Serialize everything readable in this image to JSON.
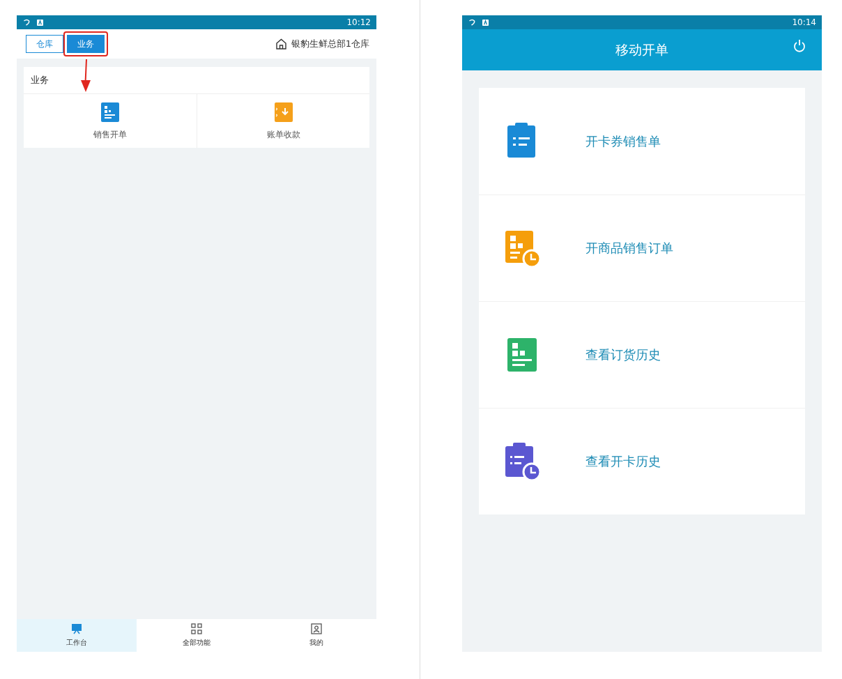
{
  "left_screen": {
    "status_bar": {
      "time": "10:12"
    },
    "tabs": [
      {
        "label": "仓库",
        "selected": false,
        "highlighted": false
      },
      {
        "label": "业务",
        "selected": true,
        "highlighted": true
      }
    ],
    "location": "银豹生鲜总部1仓库",
    "section": {
      "title": "业务",
      "items": [
        {
          "label": "销售开单",
          "kind": "doc",
          "color": "#1a8ad6"
        },
        {
          "label": "账单收款",
          "kind": "receive",
          "color": "#f5a01a"
        }
      ]
    },
    "bottom_nav": [
      {
        "label": "工作台",
        "kind": "desk",
        "selected": true
      },
      {
        "label": "全部功能",
        "kind": "grid",
        "selected": false
      },
      {
        "label": "我的",
        "kind": "profile",
        "selected": false
      }
    ]
  },
  "right_screen": {
    "status_bar": {
      "time": "10:14"
    },
    "title": "移动开单",
    "items": [
      {
        "label": "开卡券销售单",
        "kind": "clipboard",
        "color": "#1a8ad6"
      },
      {
        "label": "开商品销售订单",
        "kind": "doc-clock",
        "color": "#f59e0b"
      },
      {
        "label": "查看订货历史",
        "kind": "doc",
        "color": "#2db36a"
      },
      {
        "label": "查看开卡历史",
        "kind": "clipboard-clock",
        "color": "#5b57d1"
      }
    ]
  }
}
